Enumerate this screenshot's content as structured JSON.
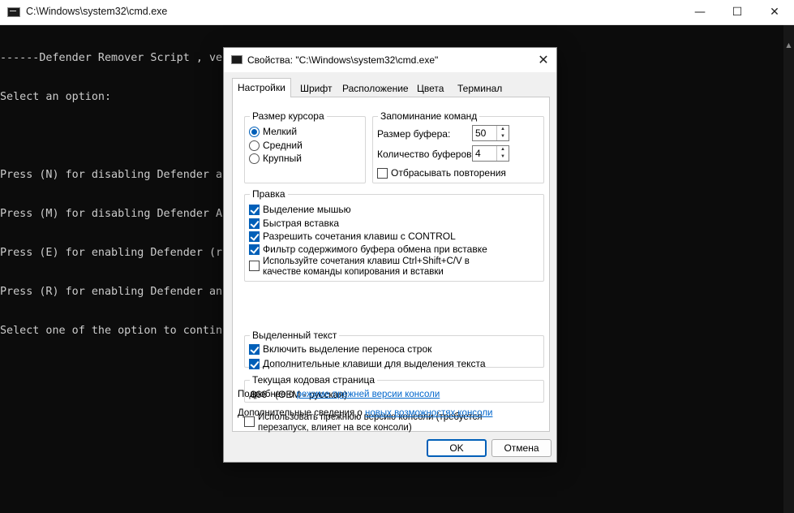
{
  "console": {
    "title": "C:\\Windows\\system32\\cmd.exe",
    "lines": [
      "------Defender Remover Script , version 12.5 ------",
      "Select an option:",
      "",
      "Press (N) for disabling Defender a",
      "Press (M) for disabling Defender A",
      "Press (E) for enabling Defender (r",
      "Press (R) for enabling Defender an                                          essed)",
      "Select one of the option to contin"
    ]
  },
  "dialog": {
    "title": "Свойства: \"C:\\Windows\\system32\\cmd.exe\"",
    "tabs": [
      {
        "label": "Настройки",
        "active": true
      },
      {
        "label": "Шрифт",
        "active": false
      },
      {
        "label": "Расположение",
        "active": false
      },
      {
        "label": "Цвета",
        "active": false
      },
      {
        "label": "Терминал",
        "active": false
      }
    ],
    "cursor_size": {
      "legend": "Размер курсора",
      "options": [
        "Мелкий",
        "Средний",
        "Крупный"
      ],
      "selected": "Мелкий"
    },
    "command_history": {
      "legend": "Запоминание команд",
      "buffer_size_label": "Размер буфера:",
      "buffer_size_value": "50",
      "buffer_count_label": "Количество буферов:",
      "buffer_count_value": "4",
      "discard_duplicates_label": "Отбрасывать повторения",
      "discard_duplicates_checked": false
    },
    "edit_options": {
      "legend": "Правка",
      "items": [
        {
          "label": "Выделение мышью",
          "checked": true
        },
        {
          "label": "Быстрая вставка",
          "checked": true
        },
        {
          "label": "Разрешить сочетания клавиш с CONTROL",
          "checked": true
        },
        {
          "label": "Фильтр содержимого буфера обмена при вставке",
          "checked": true
        },
        {
          "label": "Используйте сочетания клавиш Ctrl+Shift+C/V в",
          "label2": "качестве команды копирования и вставки",
          "checked": false
        }
      ]
    },
    "text_selection": {
      "legend": "Выделенный текст",
      "items": [
        {
          "label": "Включить выделение переноса строк",
          "checked": true
        },
        {
          "label": "Дополнительные клавиши для выделения текста",
          "checked": true
        }
      ]
    },
    "codepage": {
      "legend": "Текущая кодовая страница",
      "value": "866   (OEM - русская)"
    },
    "legacy": {
      "label": "Использовать прежнюю версию консоли (требуется",
      "label2": "перезапуск, влияет на все консоли)",
      "checked": false,
      "more_prefix": "Подробнее о ",
      "more_link": "режиме прежней версии консоли",
      "info_prefix": "Дополнительные сведения о ",
      "info_link": "новых возможностях консоли"
    },
    "buttons": {
      "ok": "OK",
      "cancel": "Отмена"
    }
  },
  "colors": {
    "console_bg": "#0c0c0c",
    "console_fg": "#cccccc",
    "accent": "#005fb8",
    "link": "#0066cc"
  }
}
